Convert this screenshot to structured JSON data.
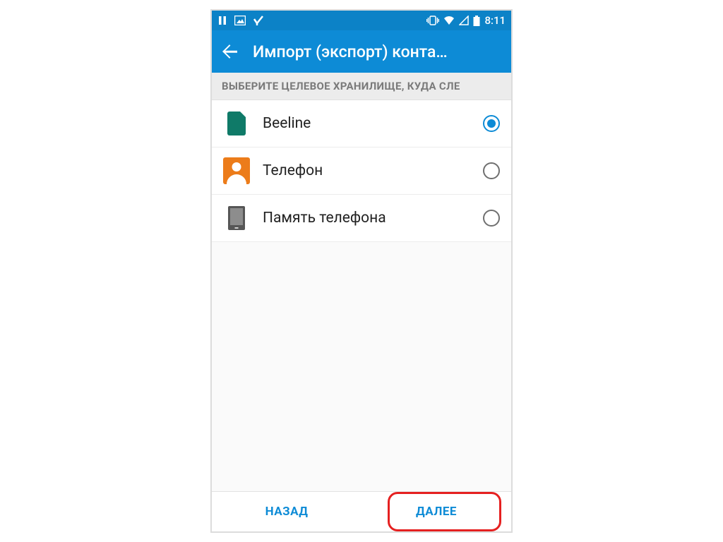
{
  "statusbar": {
    "time": "8:11"
  },
  "appbar": {
    "title": "Импорт (экспорт) конта…"
  },
  "section": {
    "header": "ВЫБЕРИТЕ ЦЕЛЕВОЕ ХРАНИЛИЩЕ, КУДА СЛЕ"
  },
  "options": [
    {
      "label": "Beeline",
      "icon": "sim-icon",
      "selected": true
    },
    {
      "label": "Телефон",
      "icon": "contact-icon",
      "selected": false
    },
    {
      "label": "Память телефона",
      "icon": "storage-icon",
      "selected": false
    }
  ],
  "footer": {
    "back": "НАЗАД",
    "next": "ДАЛЕЕ"
  },
  "colors": {
    "primary": "#0d8bd6",
    "highlight": "#e52020"
  }
}
